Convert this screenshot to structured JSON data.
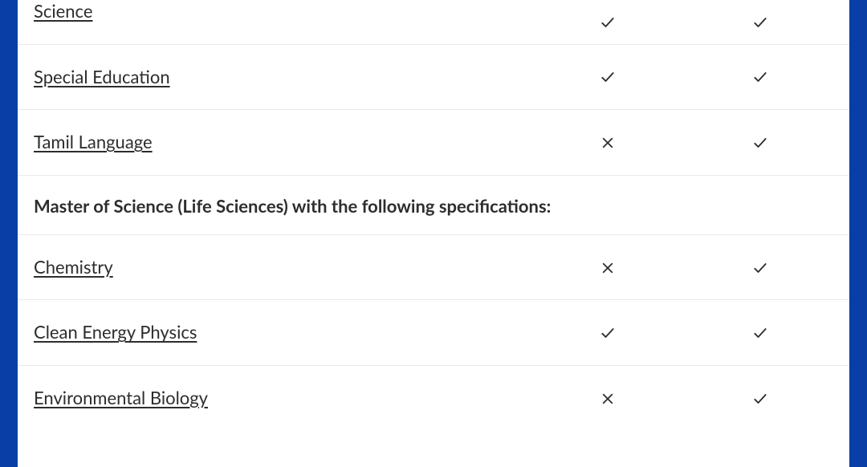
{
  "table": {
    "rows": [
      {
        "kind": "item",
        "label": "Science",
        "col1": "check",
        "col2": "check"
      },
      {
        "kind": "item",
        "label": "Special Education",
        "col1": "check",
        "col2": "check"
      },
      {
        "kind": "item",
        "label": "Tamil Language",
        "col1": "cross",
        "col2": "check"
      },
      {
        "kind": "section",
        "label": "Master of Science (Life Sciences) with the following specifications:"
      },
      {
        "kind": "item",
        "label": "Chemistry",
        "col1": "cross",
        "col2": "check"
      },
      {
        "kind": "item",
        "label": "Clean Energy Physics",
        "col1": "check",
        "col2": "check"
      },
      {
        "kind": "item",
        "label": "Environmental Biology",
        "col1": "cross",
        "col2": "check"
      }
    ]
  },
  "icons": {
    "check": "✓",
    "cross": "×"
  }
}
